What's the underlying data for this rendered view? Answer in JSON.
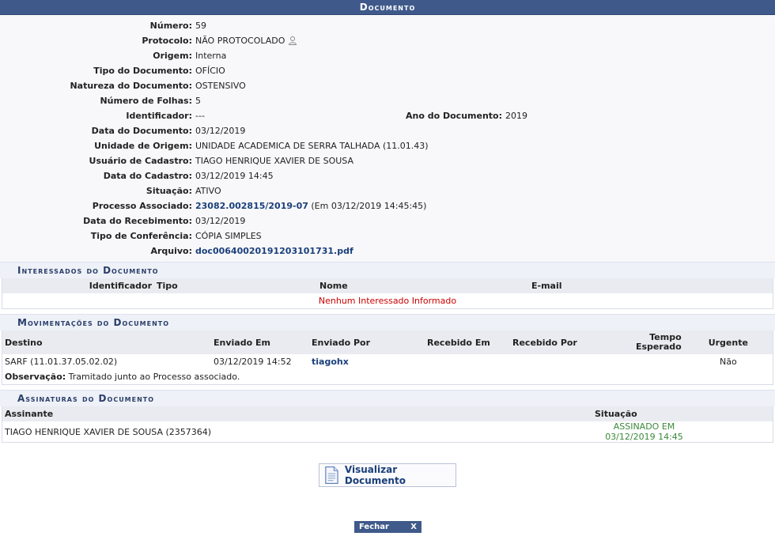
{
  "caption": "Documento",
  "fields": {
    "numero": {
      "label": "Número:",
      "value": "59"
    },
    "protocolo": {
      "label": "Protocolo:",
      "value": "NÃO PROTOCOLADO"
    },
    "origem": {
      "label": "Origem:",
      "value": "Interna"
    },
    "tipo": {
      "label": "Tipo do Documento:",
      "value": "OFÍCIO"
    },
    "natureza": {
      "label": "Natureza do Documento:",
      "value": "OSTENSIVO"
    },
    "folhas": {
      "label": "Número de Folhas:",
      "value": "5"
    },
    "identificador": {
      "label": "Identificador:",
      "value": "---"
    },
    "ano": {
      "label": "Ano do Documento:",
      "value": "2019"
    },
    "data_doc": {
      "label": "Data do Documento:",
      "value": "03/12/2019"
    },
    "unidade": {
      "label": "Unidade de Origem:",
      "value": "UNIDADE ACADEMICA DE SERRA TALHADA (11.01.43)"
    },
    "usuario": {
      "label": "Usuário de Cadastro:",
      "value": "TIAGO HENRIQUE XAVIER DE SOUSA"
    },
    "data_cad": {
      "label": "Data do Cadastro:",
      "value": "03/12/2019 14:45"
    },
    "situacao": {
      "label": "Situação:",
      "value": "ATIVO"
    },
    "processo": {
      "label": "Processo Associado:",
      "link": "23082.002815/2019-07",
      "suffix": "(Em 03/12/2019 14:45:45)"
    },
    "data_rec": {
      "label": "Data do Recebimento:",
      "value": "03/12/2019"
    },
    "conferencia": {
      "label": "Tipo de Conferência:",
      "value": "CÓPIA SIMPLES"
    },
    "arquivo": {
      "label": "Arquivo:",
      "link": "doc00640020191203101731.pdf"
    }
  },
  "interessados": {
    "title": "Interessados do Documento",
    "headers": {
      "identificador": "Identificador",
      "tipo": "Tipo",
      "nome": "Nome",
      "email": "E-mail"
    },
    "empty": "Nenhum Interessado Informado"
  },
  "movimentacoes": {
    "title": "Movimentações do Documento",
    "headers": {
      "destino": "Destino",
      "enviado_em": "Enviado Em",
      "enviado_por": "Enviado Por",
      "recebido_em": "Recebido Em",
      "recebido_por": "Recebido Por",
      "tempo": "Tempo Esperado",
      "urgente": "Urgente"
    },
    "row": {
      "destino": "SARF (11.01.37.05.02.02)",
      "enviado_em": "03/12/2019 14:52",
      "enviado_por": "tiagohx",
      "recebido_em": "",
      "recebido_por": "",
      "tempo": "",
      "urgente": "Não"
    },
    "obs_label": "Observação:",
    "obs_text": "Tramitado junto ao Processo associado."
  },
  "assinaturas": {
    "title": "Assinaturas do Documento",
    "headers": {
      "assinante": "Assinante",
      "situacao": "Situação"
    },
    "row": {
      "assinante": "TIAGO HENRIQUE XAVIER DE SOUSA (2357364)",
      "situacao": "ASSINADO EM 03/12/2019 14:45"
    }
  },
  "buttons": {
    "visualizar": "Visualizar Documento",
    "fechar": "Fechar",
    "fechar_x": "X"
  },
  "colors": {
    "header_bg": "#3f5a8a",
    "link": "#1a3f7a",
    "empty": "#cc0000",
    "signed": "#3a8a3a"
  }
}
